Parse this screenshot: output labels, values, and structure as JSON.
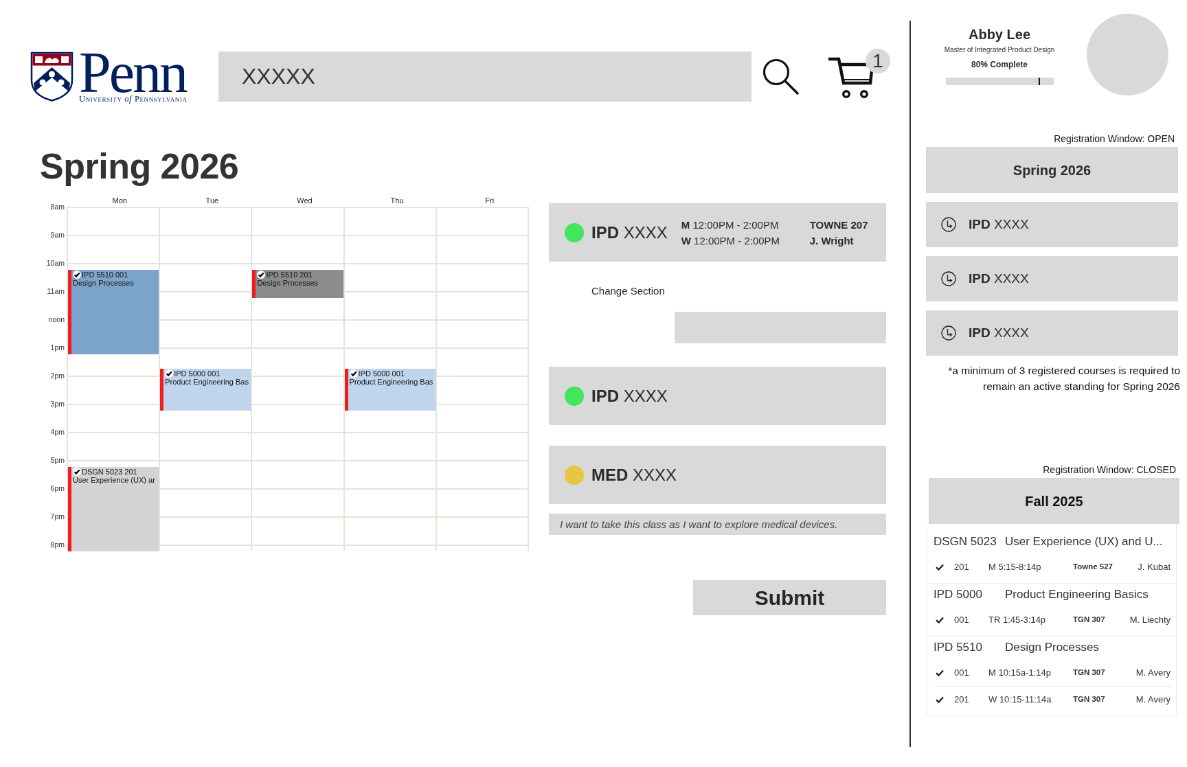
{
  "header": {
    "logo": {
      "wordmark": "Penn",
      "tagline": "University *of* Pennsylvania"
    },
    "search": {
      "value": "XXXXX"
    },
    "cart": {
      "count": "1"
    }
  },
  "page_title": "Spring 2026",
  "calendar": {
    "hours": [
      "8am",
      "9am",
      "10am",
      "11am",
      "noon",
      "1pm",
      "2pm",
      "3pm",
      "4pm",
      "5pm",
      "6pm",
      "7pm",
      "8pm"
    ],
    "days": [
      {
        "label": "Mon"
      },
      {
        "label": "Tue"
      },
      {
        "label": "Wed"
      },
      {
        "label": "Thu"
      },
      {
        "label": "Fri"
      }
    ]
  },
  "planned_courses": [
    {
      "label": "**IPD** XXXX",
      "color": "#43e55f",
      "schedule": [
        "**M** 12:00PM - 2:00PM",
        "**W** 12:00PM - 2:00PM"
      ],
      "room": "TOWNE 207",
      "instructor": "J. Wright",
      "change_section": "Change Section"
    },
    {
      "label": "**IPD** XXXX",
      "color": "#43e55f"
    },
    {
      "label": "**MED** XXXX",
      "color": "#e6c840",
      "note": "I want to take this class as I want to explore medical devices."
    }
  ],
  "submit_button": "Submit",
  "profile": {
    "name": "Abby Lee",
    "program": "Master of Integrated Product Design",
    "progress": {
      "label": "80% Complete",
      "level": 0.86
    }
  },
  "terms": [
    {
      "kind": "pending",
      "status": "Registration Window: OPEN",
      "title": "Spring 2026",
      "courses": [
        {
          "label": "**IPD** XXXX"
        },
        {
          "label": "**IPD** XXXX"
        },
        {
          "label": "**IPD** XXXX"
        }
      ],
      "footnote": "*a minimum of 3 registered courses is required to remain an active standing for Spring 2026"
    },
    {
      "kind": "registered",
      "status": "Registration Window: CLOSED",
      "title": "Fall 2025",
      "courses": [
        {
          "code": "DSGN 5023",
          "title": "User Experience (UX) and U...",
          "sections": [
            {
              "checked": true,
              "section": "201",
              "time": "M 5:15-8:14p",
              "room": "Towne 527",
              "instructor": "J. Kubat",
              "calendar_blocks": [
                {
                  "code": "DSGN 5023 201",
                  "title": "User Experience (UX) ar",
                  "color": "#d4d4d4",
                  "checked": true
                }
              ]
            }
          ]
        },
        {
          "code": "IPD 5000",
          "title": "Product Engineering Basics",
          "sections": [
            {
              "checked": true,
              "section": "001",
              "time": "TR 1:45-3:14p",
              "room": "TGN 307",
              "instructor": "M. Liechty",
              "calendar_blocks": [
                {
                  "code": "IPD 5000 001",
                  "title": "Product Engineering Bas",
                  "color": "#bed5ec",
                  "checked": true
                },
                {
                  "code": "IPD 5000 001",
                  "title": "Product Engineering Bas",
                  "color": "#bed5ec",
                  "checked": true
                }
              ]
            }
          ]
        },
        {
          "code": "IPD 5510",
          "title": "Design Processes",
          "sections": [
            {
              "checked": true,
              "section": "001",
              "time": "M 10:15a-1:14p",
              "room": "TGN 307",
              "instructor": "M. Avery",
              "calendar_blocks": [
                {
                  "code": "IPD 5510 001",
                  "title": "Design Processes",
                  "color": "#7ba3cc",
                  "checked": true
                }
              ]
            },
            {
              "checked": true,
              "section": "201",
              "time": "W 10:15-11:14a",
              "room": "TGN 307",
              "instructor": "M. Avery",
              "calendar_blocks": [
                {
                  "code": "IPD 5510 201",
                  "title": "Design Processes",
                  "color": "#8c8c8c",
                  "checked": true
                }
              ]
            }
          ]
        }
      ]
    }
  ]
}
